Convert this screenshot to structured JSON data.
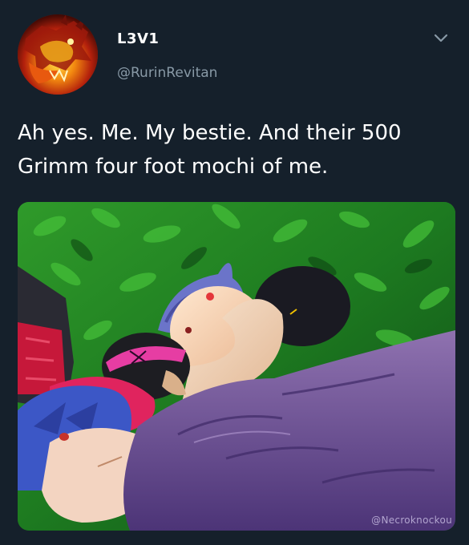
{
  "tweet": {
    "display_name": "L3V1",
    "handle": "@RurinRevitan",
    "text": "Ah yes. Me. My bestie. And their 500 Grimm four foot mochi of me."
  },
  "header": {
    "more_icon": "chevron-down-icon"
  },
  "media": {
    "watermark": "@Necroknockou"
  },
  "colors": {
    "background": "#15202b",
    "primary_text": "#ffffff",
    "secondary_text": "#8899a6"
  }
}
